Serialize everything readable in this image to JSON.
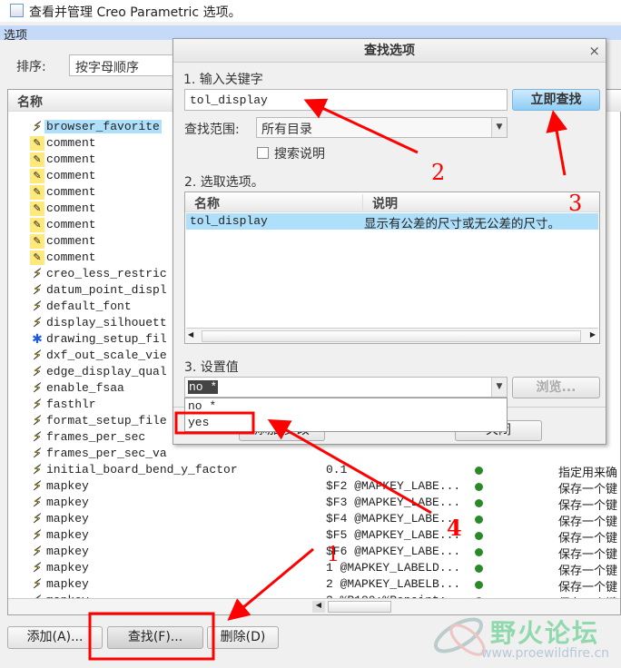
{
  "window": {
    "title": "查看并管理 Creo Parametric 选项。",
    "section": "选项"
  },
  "sort": {
    "label": "排序:",
    "value": "按字母顺序"
  },
  "list": {
    "header": "名称",
    "rows": [
      {
        "icon": "bolt",
        "name": "browser_favorite",
        "value": "",
        "desc": ""
      },
      {
        "icon": "pen",
        "name": "comment",
        "value": "",
        "desc": ""
      },
      {
        "icon": "pen",
        "name": "comment",
        "value": "",
        "desc": ""
      },
      {
        "icon": "pen",
        "name": "comment",
        "value": "",
        "desc": ""
      },
      {
        "icon": "pen",
        "name": "comment",
        "value": "",
        "desc": ""
      },
      {
        "icon": "pen",
        "name": "comment",
        "value": "",
        "desc": ""
      },
      {
        "icon": "pen",
        "name": "comment",
        "value": "",
        "desc": ""
      },
      {
        "icon": "pen",
        "name": "comment",
        "value": "",
        "desc": ""
      },
      {
        "icon": "pen",
        "name": "comment",
        "value": "",
        "desc": ""
      },
      {
        "icon": "bolt",
        "name": "creo_less_restric",
        "value": "",
        "desc": ""
      },
      {
        "icon": "bolt",
        "name": "datum_point_displ",
        "value": "",
        "desc": ""
      },
      {
        "icon": "bolt",
        "name": "default_font",
        "value": "",
        "desc": ""
      },
      {
        "icon": "bolt",
        "name": "display_silhouett",
        "value": "",
        "desc": ""
      },
      {
        "icon": "star",
        "name": "drawing_setup_fil",
        "value": "",
        "desc": ""
      },
      {
        "icon": "bolt",
        "name": "dxf_out_scale_vie",
        "value": "",
        "desc": ""
      },
      {
        "icon": "bolt",
        "name": "edge_display_qual",
        "value": "",
        "desc": ""
      },
      {
        "icon": "bolt",
        "name": "enable_fsaa",
        "value": "",
        "desc": ""
      },
      {
        "icon": "bolt",
        "name": "fasthlr",
        "value": "",
        "desc": ""
      },
      {
        "icon": "bolt",
        "name": "format_setup_file",
        "value": "",
        "desc": ""
      },
      {
        "icon": "bolt",
        "name": "frames_per_sec",
        "value": "",
        "desc": ""
      },
      {
        "icon": "bolt",
        "name": "frames_per_sec_va",
        "value": "",
        "desc": ""
      },
      {
        "icon": "bolt",
        "name": "initial_board_bend_y_factor",
        "value": "0.1",
        "desc": "指定用来确"
      },
      {
        "icon": "bolt",
        "name": "mapkey",
        "value": "$F2 @MAPKEY_LABE...",
        "desc": "保存一个键"
      },
      {
        "icon": "bolt",
        "name": "mapkey",
        "value": "$F3 @MAPKEY_LABE...",
        "desc": "保存一个键"
      },
      {
        "icon": "bolt",
        "name": "mapkey",
        "value": "$F4 @MAPKEY_LABE...",
        "desc": "保存一个键"
      },
      {
        "icon": "bolt",
        "name": "mapkey",
        "value": "$F5 @MAPKEY_LABE...",
        "desc": "保存一个键"
      },
      {
        "icon": "bolt",
        "name": "mapkey",
        "value": "$F6 @MAPKEY_LABE...",
        "desc": "保存一个键"
      },
      {
        "icon": "bolt",
        "name": "mapkey",
        "value": "1 @MAPKEY_LABELD...",
        "desc": "保存一个键"
      },
      {
        "icon": "bolt",
        "name": "mapkey",
        "value": "2 @MAPKEY_LABELB...",
        "desc": "保存一个键"
      },
      {
        "icon": "bolt",
        "name": "mapkey",
        "value": "3 %R180;%Repaint;",
        "desc": "保存一个键"
      }
    ]
  },
  "buttons": {
    "add": "添加(A)...",
    "find": "查找(F)...",
    "delete": "删除(D)"
  },
  "dialog": {
    "title": "查找选项",
    "close": "×",
    "step1": "1.  输入关键字",
    "keyword": "tol_display",
    "find_now": "立即查找",
    "scope_label": "查找范围:",
    "scope_value": "所有目录",
    "search_desc": "搜索说明",
    "step2": "2.  选取选项。",
    "table": {
      "col_name": "名称",
      "col_desc": "说明",
      "rows": [
        {
          "name": "tol_display",
          "desc": "显示有公差的尺寸或无公差的尺寸。"
        }
      ]
    },
    "step3": "3.  设置值",
    "value": "no *",
    "options": [
      "no *",
      "yes"
    ],
    "browse": "浏览...",
    "add_change": "添加/更改",
    "close_btn": "关闭"
  },
  "annotations": {
    "n1": "1",
    "n2": "2",
    "n3": "3",
    "n4": "4",
    "color": "#ff0000"
  },
  "watermark": {
    "logo": "野火论坛",
    "url": "www.proewildfire.cn"
  }
}
